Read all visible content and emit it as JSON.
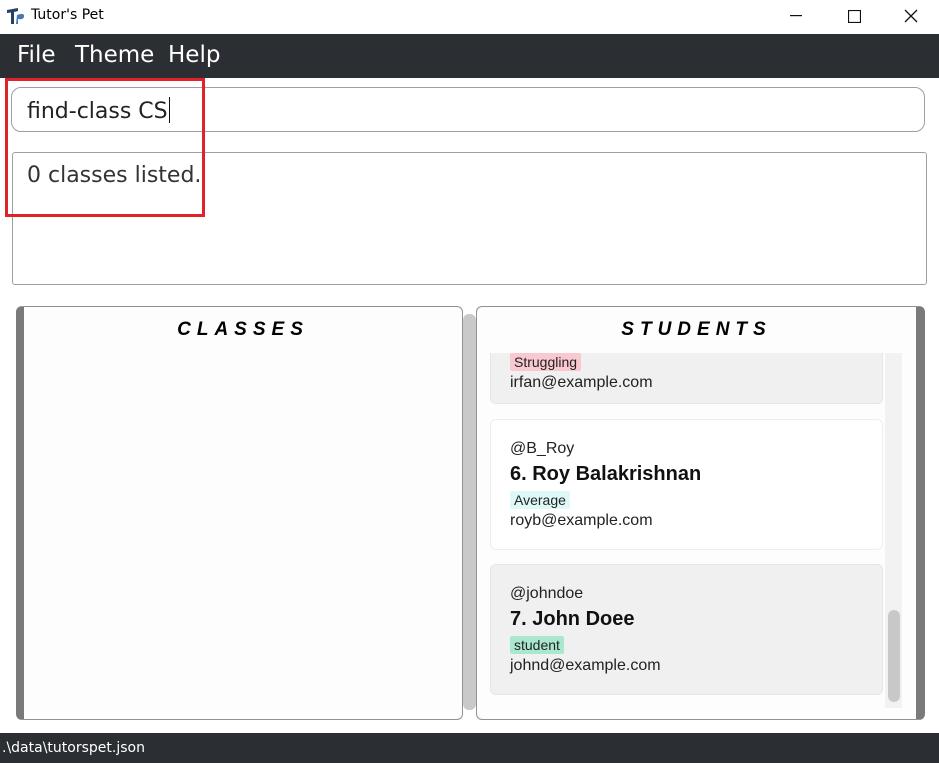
{
  "window": {
    "title": "Tutor's Pet"
  },
  "menu": {
    "items": [
      "File",
      "Theme",
      "Help"
    ]
  },
  "command": {
    "value": "find-class CS"
  },
  "result": {
    "message": "0 classes listed."
  },
  "panels": {
    "classes_title": "CLASSES",
    "students_title": "STUDENTS"
  },
  "students": [
    {
      "tag": "Struggling",
      "tag_color": "#f9c9cf",
      "email": "irfan@example.com"
    },
    {
      "handle": "@B_Roy",
      "name": "6.  Roy Balakrishnan",
      "tag": "Average",
      "tag_color": "#dff8f8",
      "email": "royb@example.com"
    },
    {
      "handle": "@johndoe",
      "name": "7.  John Doee",
      "tag": "student",
      "tag_color": "#a9e8ce",
      "email": "johnd@example.com"
    }
  ],
  "status": {
    "path": ".\\data\\tutorspet.json"
  },
  "colors": {
    "menubar": "#2b2f33",
    "highlight": "#e0232b"
  }
}
